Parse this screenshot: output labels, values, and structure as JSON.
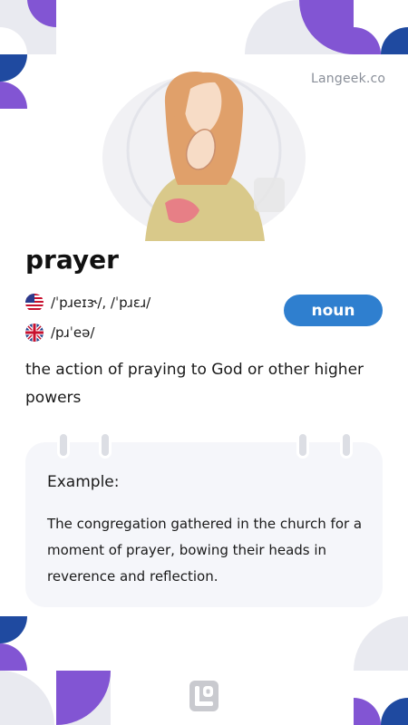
{
  "brand": {
    "site": "Langeek.co"
  },
  "entry": {
    "word": "prayer",
    "part_of_speech": "noun",
    "pronunciations": [
      {
        "flag": "us-flag-icon",
        "ipa": "/ˈpɹeɪɝ/, /ˈpɹɛɹ/"
      },
      {
        "flag": "uk-flag-icon",
        "ipa": "/pɹˈeə/"
      }
    ],
    "definition": "the action of praying to God or other higher powers"
  },
  "example": {
    "label": "Example:",
    "text": "The congregation gathered in the church for a moment of prayer, bowing their heads in reverence and reflection."
  },
  "colors": {
    "accent_purple": "#8255d3",
    "accent_blue": "#1f4aa0",
    "badge_blue": "#2f7fcf",
    "soft_gray": "#e9eaf0",
    "card_bg": "#f5f6fa"
  },
  "icons": [
    "praying-woman-illustration",
    "langeek-logo-icon"
  ]
}
